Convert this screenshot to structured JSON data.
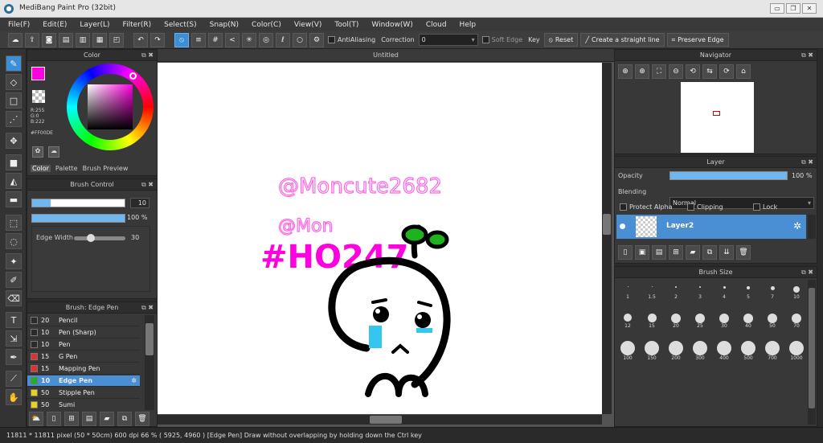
{
  "window": {
    "title": "MediBang Paint Pro (32bit)",
    "app_icon": "medibang-icon"
  },
  "menu": [
    "File(F)",
    "Edit(E)",
    "Layer(L)",
    "Filter(R)",
    "Select(S)",
    "Snap(N)",
    "Color(C)",
    "View(V)",
    "Tool(T)",
    "Window(W)",
    "Cloud",
    "Help"
  ],
  "toolbar": {
    "antialiasing_label": "AntiAliasing",
    "correction_label": "Correction",
    "correction_value": "0",
    "soft_edge_label": "Soft Edge",
    "key_label": "Key",
    "reset_label": "Reset",
    "straight_line_label": "Create a straight line",
    "preserve_edge_label": "Preserve Edge"
  },
  "color_panel": {
    "title": "Color",
    "r": "R:255",
    "g": "G:0",
    "b": "B:222",
    "hex": "#FF00DE",
    "tabs": [
      "Color",
      "Palette",
      "Brush Preview"
    ],
    "primary": "#FF00DE"
  },
  "brush_control": {
    "title": "Brush Control",
    "size_value": "10",
    "size_fraction": 0.2,
    "opacity_value": "100 %",
    "opacity_fraction": 1.0,
    "edge_width_label": "Edge Width",
    "edge_width_value": "30",
    "edge_width_fraction": 0.3
  },
  "brush_list": {
    "title": "Brush: Edge Pen",
    "items": [
      {
        "size": "20",
        "name": "Pencil",
        "color": "#2b2b2b"
      },
      {
        "size": "10",
        "name": "Pen (Sharp)",
        "color": "#2b2b2b"
      },
      {
        "size": "10",
        "name": "Pen",
        "color": "#2b2b2b"
      },
      {
        "size": "15",
        "name": "G Pen",
        "color": "#e03030"
      },
      {
        "size": "15",
        "name": "Mapping Pen",
        "color": "#e03030"
      },
      {
        "size": "10",
        "name": "Edge Pen",
        "color": "#1db31d"
      },
      {
        "size": "50",
        "name": "Stipple Pen",
        "color": "#e8d21a"
      },
      {
        "size": "50",
        "name": "Sumi",
        "color": "#e8d21a"
      }
    ],
    "selected_index": 5
  },
  "canvas": {
    "title": "Untitled"
  },
  "drawing": {
    "text1": "@Moncute2682",
    "text2": "@Mon",
    "text3": "#HO247"
  },
  "navigator": {
    "title": "Navigator"
  },
  "layer_panel": {
    "title": "Layer",
    "opacity_label": "Opacity",
    "opacity_value": "100 %",
    "opacity_fraction": 1.0,
    "blending_label": "Blending",
    "blending_value": "Normal",
    "protect_alpha_label": "Protect Alpha",
    "clipping_label": "Clipping",
    "lock_label": "Lock",
    "layer_name": "Layer2"
  },
  "brush_size": {
    "title": "Brush Size",
    "sizes": [
      "1",
      "1.5",
      "2",
      "3",
      "4",
      "5",
      "7",
      "10",
      "12",
      "15",
      "20",
      "25",
      "30",
      "40",
      "50",
      "70",
      "100",
      "150",
      "200",
      "300",
      "400",
      "500",
      "700",
      "1000"
    ]
  },
  "status": {
    "text": "11811 * 11811 pixel  (50 * 50cm)  600 dpi  66 %  ( 5925, 4960 )  [Edge Pen] Draw without overlapping by holding down the Ctrl key"
  },
  "colors": {
    "accent": "#3c8fd6",
    "magenta": "#FF00DE",
    "green": "#1db31d",
    "cyan": "#35c6f0"
  }
}
